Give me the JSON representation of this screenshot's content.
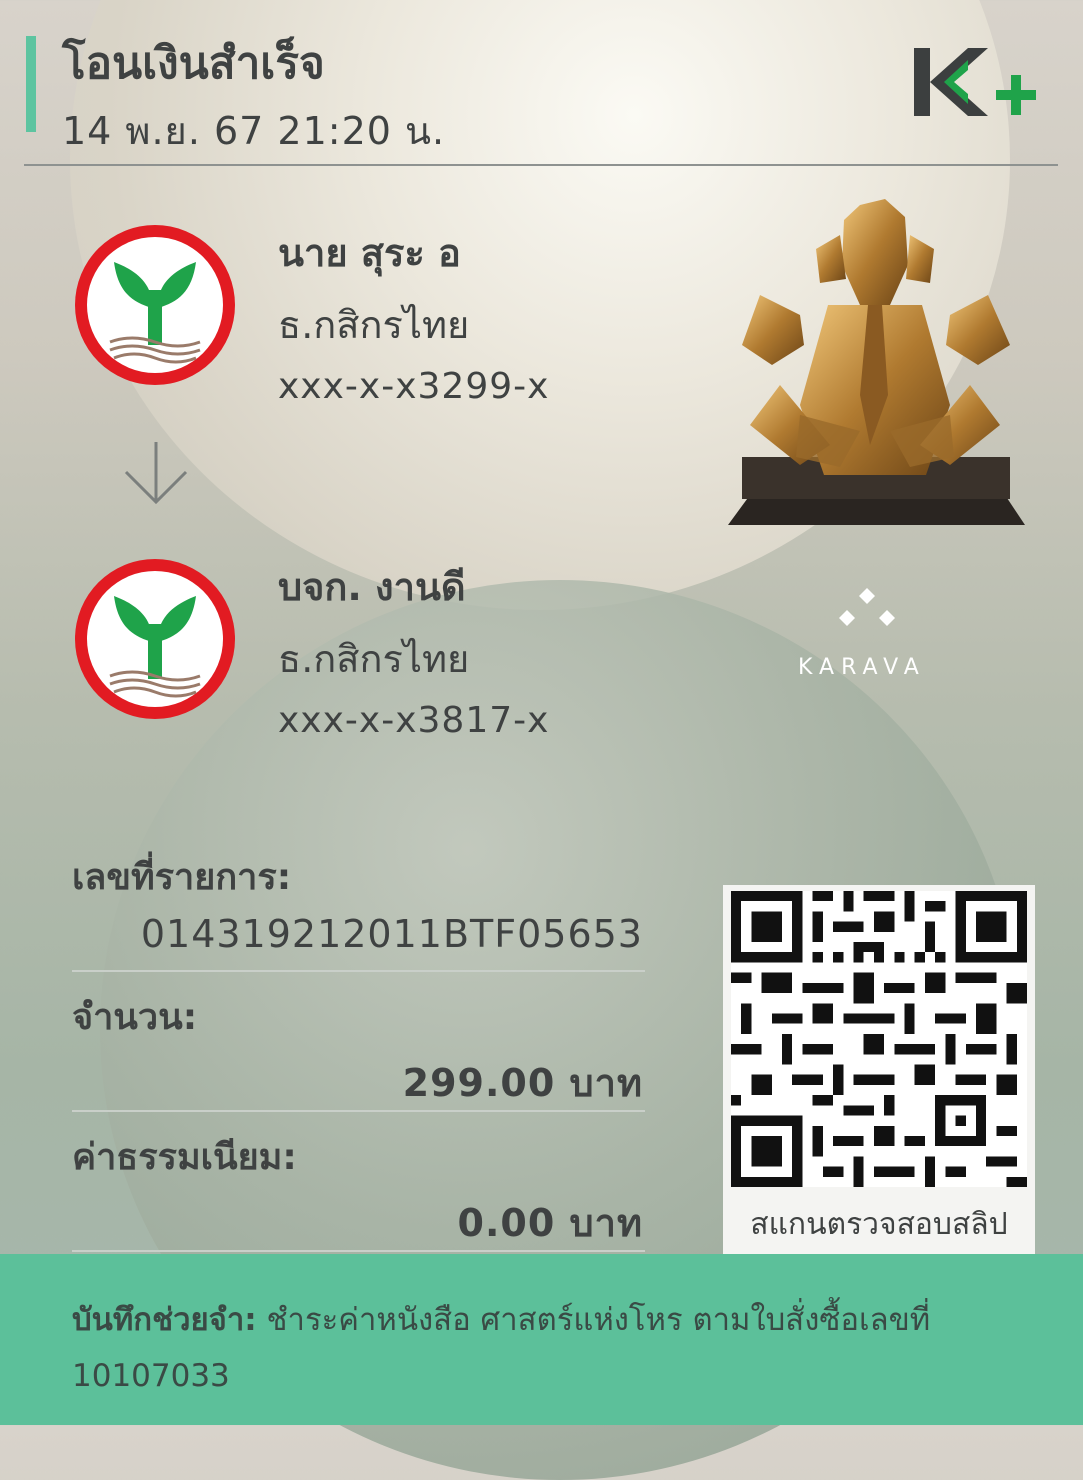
{
  "header": {
    "title": "โอนเงินสำเร็จ",
    "datetime": "14 พ.ย. 67  21:20 น."
  },
  "sender": {
    "name": "นาย สุระ อ",
    "bank": "ธ.กสิกรไทย",
    "account": "xxx-x-x3299-x"
  },
  "receiver": {
    "name": "บจก. งานดี",
    "bank": "ธ.กสิกรไทย",
    "account": "xxx-x-x3817-x"
  },
  "ad": {
    "brand": "KARAVA"
  },
  "details": {
    "ref_label": "เลขที่รายการ:",
    "ref_value": "014319212011BTF05653",
    "amount_label": "จำนวน:",
    "amount_value": "299.00 บาท",
    "fee_label": "ค่าธรรมเนียม:",
    "fee_value": "0.00 บาท"
  },
  "qr": {
    "caption": "สแกนตรวจสอบสลิป"
  },
  "memo": {
    "label": "บันทึกช่วยจำ:",
    "text": " ชำระค่าหนังสือ ศาสตร์แห่งโหร ตามใบสั่งซื้อเลขที่ 10107033"
  },
  "colors": {
    "accent": "#5dc4a0",
    "kbank_green": "#1fa34a",
    "kbank_red": "#e21b22",
    "memo_bg": "#5cc09a"
  }
}
